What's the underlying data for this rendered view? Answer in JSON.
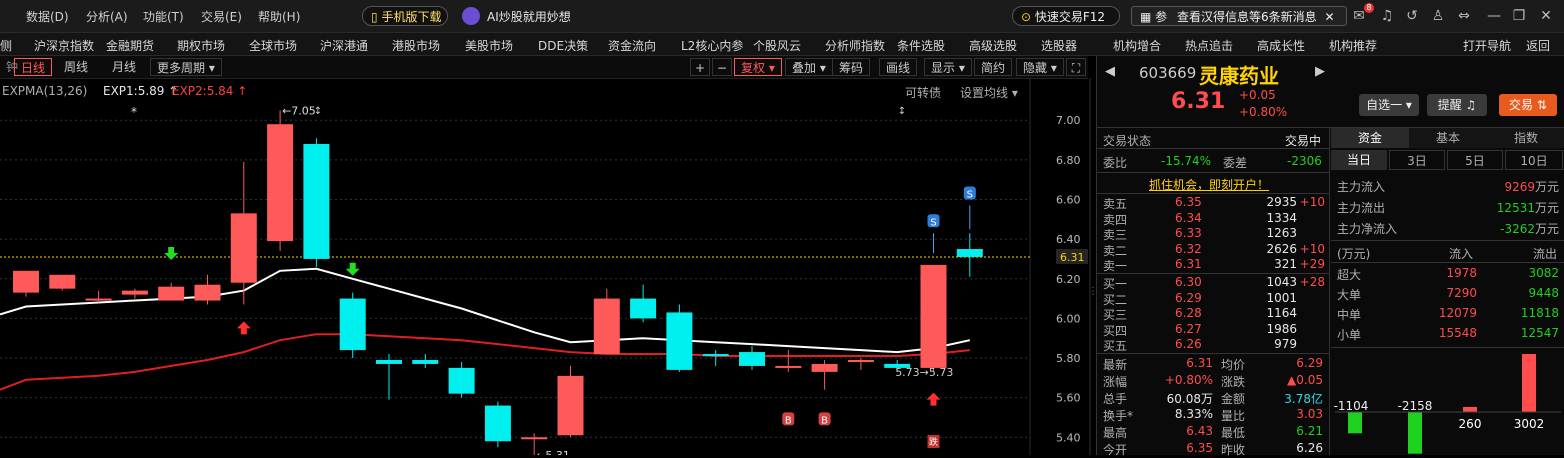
{
  "menu": {
    "items": [
      "数据(D)",
      "分析(A)",
      "功能(T)",
      "交易(E)",
      "帮助(H)"
    ],
    "mobile_download": "手机版下载",
    "ai_promo": "AI炒股就用妙想",
    "quick_trade": "快速交易F12",
    "news_prefix": "参",
    "news_title": "查看汉得信息等6条新消息",
    "mail_badge": "8"
  },
  "nav": {
    "items": [
      "沪深京指数",
      "金融期货",
      "期权市场",
      "全球市场",
      "沪深港通",
      "港股市场",
      "美股市场",
      "DDE决策",
      "资金流向",
      "L2核心内参",
      "个股风云",
      "分析师指数",
      "条件选股",
      "高级选股",
      "选股器",
      "机构增合",
      "热点追击",
      "高成长性",
      "机构推荐"
    ],
    "right_items": [
      "打开导航",
      "返回"
    ]
  },
  "toolbar": {
    "period_tabs": [
      "日线",
      "周线",
      "月线"
    ],
    "active_period": "日线",
    "more_period": "更多周期",
    "right_buttons": [
      "+",
      "−",
      "复权",
      "叠加",
      "筹码",
      "画线",
      "显示",
      "简约",
      "隐藏"
    ]
  },
  "indicator": {
    "name": "EXPMA(13,26)",
    "exp1_label": "EXP1:5.89",
    "exp2_label": "EXP2:5.84",
    "lock_text": "可转债",
    "settings_text": "设置均线"
  },
  "chart_data": {
    "type": "candlestick",
    "yticks": [
      "7.00",
      "6.80",
      "6.60",
      "6.40",
      "6.20",
      "6.00",
      "5.80",
      "5.60",
      "5.40"
    ],
    "ylim": [
      5.32,
      7.08
    ],
    "current_price_label": "6.31",
    "candles": [
      {
        "o": 6.13,
        "c": 6.24,
        "h": 6.24,
        "l": 6.11
      },
      {
        "o": 6.15,
        "c": 6.22,
        "h": 6.22,
        "l": 6.14
      },
      {
        "o": 6.1,
        "c": 6.1,
        "h": 6.14,
        "l": 6.08
      },
      {
        "o": 6.12,
        "c": 6.14,
        "h": 6.15,
        "l": 6.1
      },
      {
        "o": 6.09,
        "c": 6.16,
        "h": 6.18,
        "l": 6.09
      },
      {
        "o": 6.09,
        "c": 6.17,
        "h": 6.22,
        "l": 6.07
      },
      {
        "o": 6.18,
        "c": 6.53,
        "h": 6.79,
        "l": 6.07
      },
      {
        "o": 6.39,
        "c": 6.98,
        "h": 7.05,
        "l": 6.34
      },
      {
        "o": 6.88,
        "c": 6.3,
        "h": 6.91,
        "l": 6.26
      },
      {
        "o": 6.1,
        "c": 5.84,
        "h": 6.13,
        "l": 5.8
      },
      {
        "o": 5.79,
        "c": 5.77,
        "h": 5.82,
        "l": 5.59
      },
      {
        "o": 5.79,
        "c": 5.77,
        "h": 5.82,
        "l": 5.75
      },
      {
        "o": 5.75,
        "c": 5.62,
        "h": 5.78,
        "l": 5.6
      },
      {
        "o": 5.56,
        "c": 5.38,
        "h": 5.58,
        "l": 5.35
      },
      {
        "o": 5.4,
        "c": 5.4,
        "h": 5.42,
        "l": 5.31
      },
      {
        "o": 5.41,
        "c": 5.71,
        "h": 5.76,
        "l": 5.4
      },
      {
        "o": 5.82,
        "c": 6.1,
        "h": 6.15,
        "l": 5.82
      },
      {
        "o": 6.1,
        "c": 6.0,
        "h": 6.17,
        "l": 5.98
      },
      {
        "o": 6.03,
        "c": 5.74,
        "h": 6.07,
        "l": 5.73
      },
      {
        "o": 5.82,
        "c": 5.81,
        "h": 5.84,
        "l": 5.76
      },
      {
        "o": 5.83,
        "c": 5.76,
        "h": 5.86,
        "l": 5.74
      },
      {
        "o": 5.76,
        "c": 5.76,
        "h": 5.84,
        "l": 5.73
      },
      {
        "o": 5.73,
        "c": 5.77,
        "h": 5.79,
        "l": 5.64
      },
      {
        "o": 5.78,
        "c": 5.79,
        "h": 5.8,
        "l": 5.74
      },
      {
        "o": 5.77,
        "c": 5.75,
        "h": 5.79,
        "l": 5.73
      },
      {
        "o": 5.75,
        "c": 6.27,
        "h": 6.27,
        "l": 5.73
      },
      {
        "o": 6.35,
        "c": 6.31,
        "h": 6.43,
        "l": 6.21
      }
    ],
    "ema1": [
      6.06,
      6.07,
      6.08,
      6.09,
      6.1,
      6.11,
      6.14,
      6.24,
      6.25,
      6.2,
      6.15,
      6.1,
      6.05,
      5.99,
      5.93,
      5.88,
      5.89,
      5.9,
      5.89,
      5.88,
      5.87,
      5.86,
      5.85,
      5.84,
      5.83,
      5.85,
      5.89
    ],
    "ema2": [
      5.69,
      5.7,
      5.71,
      5.73,
      5.76,
      5.79,
      5.83,
      5.89,
      5.92,
      5.92,
      5.91,
      5.9,
      5.89,
      5.87,
      5.85,
      5.83,
      5.82,
      5.82,
      5.82,
      5.81,
      5.81,
      5.81,
      5.81,
      5.81,
      5.81,
      5.82,
      5.84
    ],
    "annotations": {
      "high": "7.05",
      "low": "5.31",
      "recent_low": "5.73",
      "recent_low2": "5.73"
    },
    "markers": {
      "buy": "B",
      "sell": "S",
      "special": "跌"
    }
  },
  "quote": {
    "code": "603669",
    "name": "灵康药业",
    "price": "6.31",
    "change": "+0.05",
    "change_pct": "+0.80%",
    "watch_btn": "自选一",
    "alert_btn": "提醒",
    "trade_btn": "交易",
    "status_label": "交易状态",
    "status_value": "交易中",
    "weibi_label": "委比",
    "weibi_value": "-15.74%",
    "weicha_label": "委差",
    "weicha_value": "-2306",
    "promo": "抓住机会，即刻开户！",
    "asks": [
      {
        "label": "卖五",
        "price": "6.35",
        "vol": "2935",
        "chg": "+10"
      },
      {
        "label": "卖四",
        "price": "6.34",
        "vol": "1334",
        "chg": ""
      },
      {
        "label": "卖三",
        "price": "6.33",
        "vol": "1263",
        "chg": ""
      },
      {
        "label": "卖二",
        "price": "6.32",
        "vol": "2626",
        "chg": "+10"
      },
      {
        "label": "卖一",
        "price": "6.31",
        "vol": "321",
        "chg": "+29"
      }
    ],
    "bids": [
      {
        "label": "买一",
        "price": "6.30",
        "vol": "1043",
        "chg": "+28"
      },
      {
        "label": "买二",
        "price": "6.29",
        "vol": "1001",
        "chg": ""
      },
      {
        "label": "买三",
        "price": "6.28",
        "vol": "1164",
        "chg": ""
      },
      {
        "label": "买四",
        "price": "6.27",
        "vol": "1986",
        "chg": ""
      },
      {
        "label": "买五",
        "price": "6.26",
        "vol": "979",
        "chg": ""
      }
    ],
    "stats": [
      {
        "l1": "最新",
        "v1": "6.31",
        "l2": "均价",
        "v2": "6.29"
      },
      {
        "l1": "涨幅",
        "v1": "+0.80%",
        "l2": "涨跌",
        "v2": "▲0.05"
      },
      {
        "l1": "总手",
        "v1": "60.08万",
        "l2": "金额",
        "v2": "3.78亿"
      },
      {
        "l1": "换手*",
        "v1": "8.33%",
        "l2": "量比",
        "v2": "3.03"
      },
      {
        "l1": "最高",
        "v1": "6.43",
        "l2": "最低",
        "v2": "6.21"
      },
      {
        "l1": "今开",
        "v1": "6.35",
        "l2": "昨收",
        "v2": "6.26"
      }
    ]
  },
  "fund": {
    "tabs": [
      "资金",
      "基本",
      "指数"
    ],
    "periods": [
      "当日",
      "3日",
      "5日",
      "10日"
    ],
    "main_in_label": "主力流入",
    "main_in_value": "9269",
    "main_out_label": "主力流出",
    "main_out_value": "12531",
    "main_net_label": "主力净流入",
    "main_net_value": "-3262",
    "unit": "万元",
    "table_header": [
      "(万元)",
      "流入",
      "流出"
    ],
    "rows": [
      {
        "label": "超大",
        "in": "1978",
        "out": "3082"
      },
      {
        "label": "大单",
        "in": "7290",
        "out": "9448"
      },
      {
        "label": "中单",
        "in": "12079",
        "out": "11818"
      },
      {
        "label": "小单",
        "in": "15548",
        "out": "12547"
      }
    ],
    "bars": [
      {
        "label": "-1104",
        "value": -1104
      },
      {
        "label": "-2158",
        "value": -2158
      },
      {
        "label": "260",
        "value": 260
      },
      {
        "label": "3002",
        "value": 3002
      }
    ]
  },
  "colors": {
    "up": "#ff5a5a",
    "down": "#00f0f0",
    "ema1": "#ffffff",
    "ema2": "#e02020",
    "price_line": "#ffd200"
  }
}
